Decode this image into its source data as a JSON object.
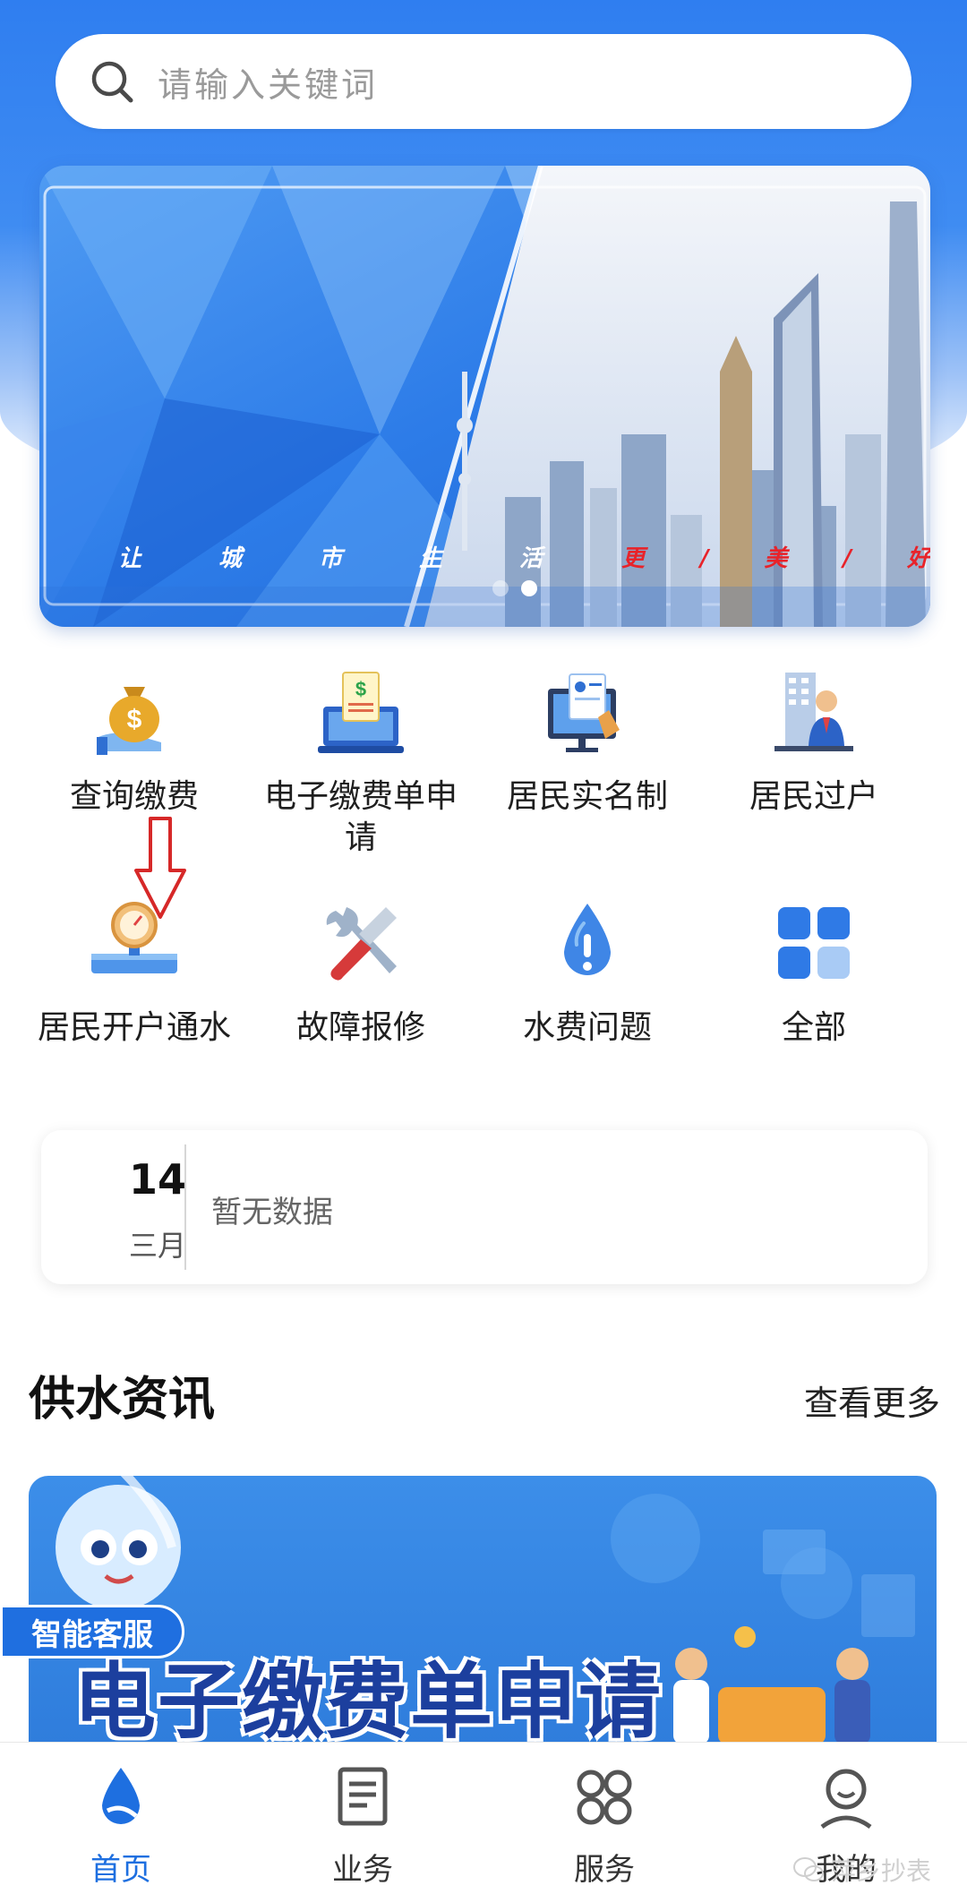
{
  "search": {
    "placeholder": "请输入关键词"
  },
  "banner": {
    "slogan_left": "让城市生活",
    "slogan_right": "更/美/好",
    "slide_count": 2,
    "active_slide": 2
  },
  "services": [
    {
      "label": "查询缴费",
      "icon": "money-bag-icon"
    },
    {
      "label": "电子缴费单申请",
      "icon": "invoice-laptop-icon"
    },
    {
      "label": "居民实名制",
      "icon": "id-verification-icon"
    },
    {
      "label": "居民过户",
      "icon": "transfer-person-icon"
    },
    {
      "label": "居民开户通水",
      "icon": "water-meter-icon"
    },
    {
      "label": "故障报修",
      "icon": "repair-tools-icon"
    },
    {
      "label": "水费问题",
      "icon": "water-drop-alert-icon"
    },
    {
      "label": "全部",
      "icon": "grid-all-icon"
    }
  ],
  "notice": {
    "day": "14",
    "month": "三月",
    "message": "暂无数据"
  },
  "news": {
    "title": "供水资讯",
    "more": "查看更多",
    "banner_headline": "电子缴费单申请"
  },
  "assistant": {
    "label": "智能客服"
  },
  "tabbar": {
    "items": [
      {
        "label": "首页",
        "icon": "water-drop-icon",
        "active": true
      },
      {
        "label": "业务",
        "icon": "document-icon",
        "active": false
      },
      {
        "label": "服务",
        "icon": "apps-icon",
        "active": false
      },
      {
        "label": "我的",
        "icon": "profile-icon",
        "active": false
      }
    ]
  },
  "watermark": "萍乡抄表",
  "colors": {
    "primary": "#1e6fe0",
    "accent_red": "#e8232a"
  }
}
